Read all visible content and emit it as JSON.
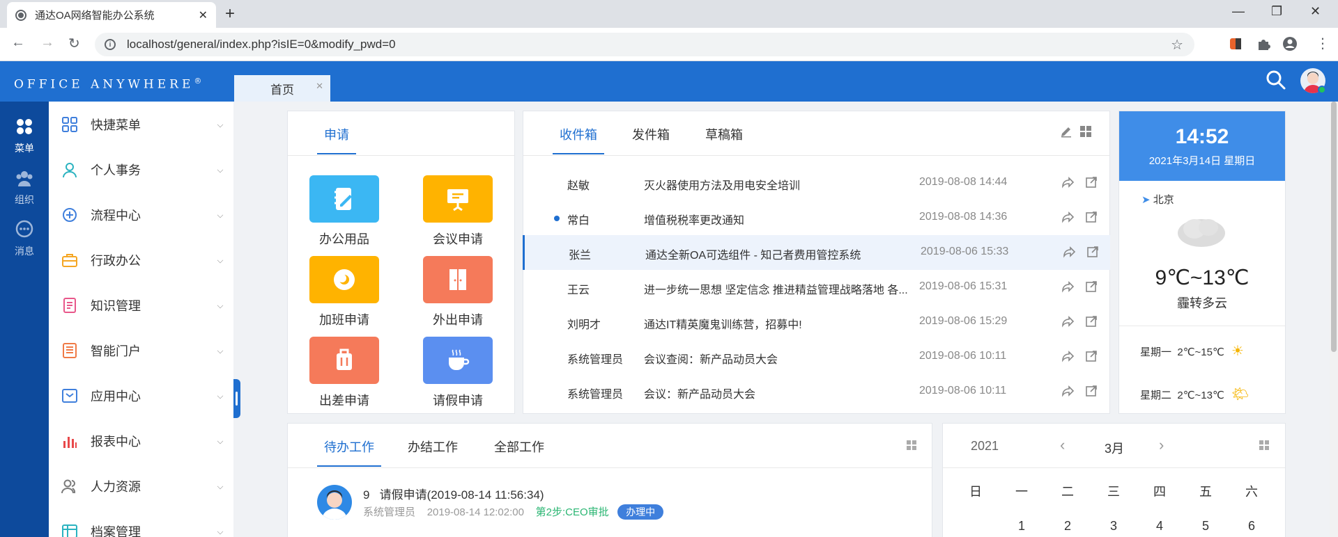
{
  "browser": {
    "tab_title": "通达OA网络智能办公系统",
    "url": "localhost/general/index.php?isIE=0&modify_pwd=0"
  },
  "app": {
    "logo": "Office Anywhere",
    "logo_mark": "®",
    "page_tab": "首页"
  },
  "rail": {
    "menu": "菜单",
    "org": "组织",
    "msg": "消息"
  },
  "menu": {
    "items": [
      {
        "label": "快捷菜单",
        "icon": "grid-icon"
      },
      {
        "label": "个人事务",
        "icon": "user-icon"
      },
      {
        "label": "流程中心",
        "icon": "flow-icon"
      },
      {
        "label": "行政办公",
        "icon": "briefcase-icon"
      },
      {
        "label": "知识管理",
        "icon": "book-icon"
      },
      {
        "label": "智能门户",
        "icon": "portal-icon"
      },
      {
        "label": "应用中心",
        "icon": "monitor-icon"
      },
      {
        "label": "报表中心",
        "icon": "bar-chart-icon"
      },
      {
        "label": "人力资源",
        "icon": "people-icon"
      },
      {
        "label": "档案管理",
        "icon": "archive-icon"
      }
    ]
  },
  "apply": {
    "tab": "申请",
    "apps": [
      {
        "label": "办公用品",
        "color": "#3bb7f3"
      },
      {
        "label": "会议申请",
        "color": "#ffb300"
      },
      {
        "label": "加班申请",
        "color": "#ffb300"
      },
      {
        "label": "外出申请",
        "color": "#f57a5a"
      },
      {
        "label": "出差申请",
        "color": "#f57a5a"
      },
      {
        "label": "请假申请",
        "color": "#5b8ff0"
      }
    ]
  },
  "mail": {
    "tabs": [
      "收件箱",
      "发件箱",
      "草稿箱"
    ],
    "rows": [
      {
        "from": "赵敏",
        "subject": "灭火器使用方法及用电安全培训",
        "time": "2019-08-08 14:44"
      },
      {
        "from": "常白",
        "subject": "增值税税率更改通知",
        "time": "2019-08-08 14:36",
        "unread": true
      },
      {
        "from": "张兰",
        "subject": "通达全新OA可选组件 - 知己者费用管控系统",
        "time": "2019-08-06 15:33",
        "selected": true
      },
      {
        "from": "王云",
        "subject": "进一步统一思想 坚定信念 推进精益管理战略落地 各...",
        "time": "2019-08-06 15:31"
      },
      {
        "from": "刘明才",
        "subject": "通达IT精英魔鬼训练营，招募中!",
        "time": "2019-08-06 15:29"
      },
      {
        "from": "系统管理员",
        "subject": "会议查阅：新产品动员大会",
        "time": "2019-08-06 10:11"
      },
      {
        "from": "系统管理员",
        "subject": "会议：新产品动员大会",
        "time": "2019-08-06 10:11"
      }
    ]
  },
  "weather": {
    "clock": "14:52",
    "date": "2021年3月14日  星期日",
    "city": "北京",
    "temp": "9℃~13℃",
    "desc": "霾转多云",
    "forecast": [
      {
        "day": "星期一",
        "temp": "2℃~15℃"
      },
      {
        "day": "星期二",
        "temp": "2℃~13℃"
      }
    ]
  },
  "work": {
    "tabs": [
      "待办工作",
      "办结工作",
      "全部工作"
    ],
    "item": {
      "num": "9",
      "title": "请假申请(2019-08-14 11:56:34)",
      "user": "系统管理员",
      "time": "2019-08-14 12:02:00",
      "step": "第2步:CEO审批",
      "status": "办理中"
    }
  },
  "calendar": {
    "year": "2021",
    "month": "3月",
    "weekdays": [
      "日",
      "一",
      "二",
      "三",
      "四",
      "五",
      "六"
    ],
    "first_row": [
      "",
      "1",
      "2",
      "3",
      "4",
      "5",
      "6"
    ]
  }
}
